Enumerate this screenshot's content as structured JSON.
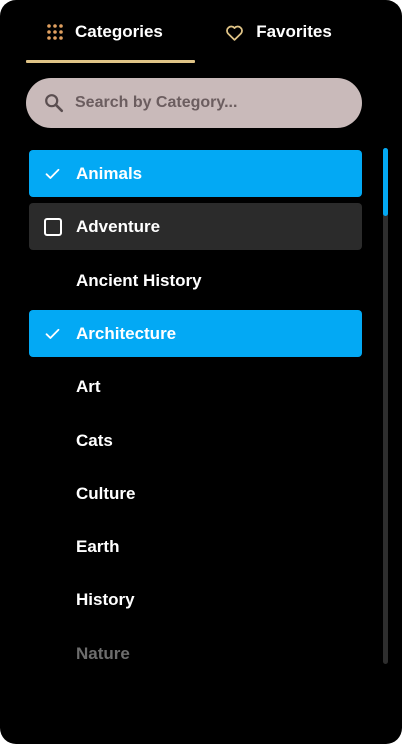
{
  "tabs": {
    "categories": {
      "label": "Categories",
      "icon": "grid-dots-icon",
      "active": true
    },
    "favorites": {
      "label": "Favorites",
      "icon": "heart-outline-icon",
      "active": false
    }
  },
  "search": {
    "placeholder": "Search by Category...",
    "value": "",
    "icon": "search-icon"
  },
  "categories": [
    {
      "label": "Animals",
      "state": "selected"
    },
    {
      "label": "Adventure",
      "state": "hovered"
    },
    {
      "label": "Ancient History",
      "state": "normal"
    },
    {
      "label": "Architecture",
      "state": "selected"
    },
    {
      "label": "Art",
      "state": "normal"
    },
    {
      "label": "Cats",
      "state": "normal"
    },
    {
      "label": "Culture",
      "state": "normal"
    },
    {
      "label": "Earth",
      "state": "normal"
    },
    {
      "label": "History",
      "state": "normal"
    },
    {
      "label": "Nature",
      "state": "faded"
    }
  ],
  "colors": {
    "background": "#000000",
    "accent_tab": "#e0c487",
    "selected": "#03a9f4",
    "hover": "#2b2b2b",
    "search_bg": "#c9baba"
  }
}
